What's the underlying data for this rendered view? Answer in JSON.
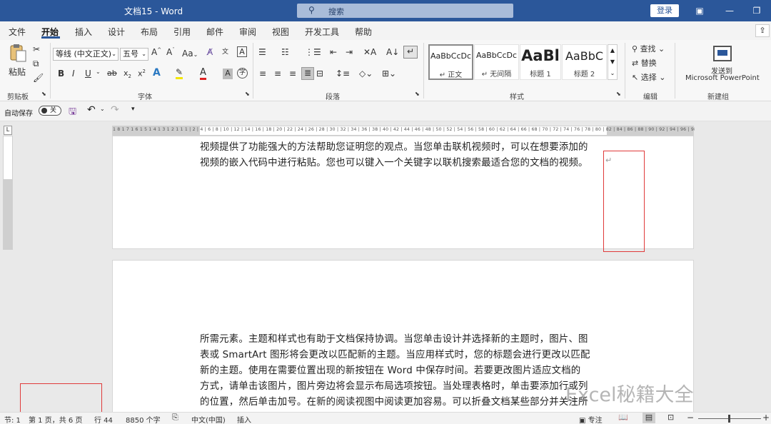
{
  "titlebar": {
    "title": "文档15 - Word",
    "search_placeholder": "搜索",
    "login": "登录"
  },
  "tabs": [
    "文件",
    "开始",
    "插入",
    "设计",
    "布局",
    "引用",
    "邮件",
    "审阅",
    "视图",
    "开发工具",
    "帮助"
  ],
  "clipboard": {
    "paste": "粘贴",
    "group": "剪贴板"
  },
  "font": {
    "name": "等线 (中文正文)",
    "size": "五号",
    "aa": "Aa",
    "group": "字体"
  },
  "paragraph": {
    "group": "段落"
  },
  "styles": {
    "items": [
      {
        "sample": "AaBbCcDc",
        "label": "正文"
      },
      {
        "sample": "AaBbCcDc",
        "label": "无间隔"
      },
      {
        "sample": "AaBl",
        "label": "标题 1"
      },
      {
        "sample": "AaBbC",
        "label": "标题 2"
      }
    ],
    "group": "样式"
  },
  "editing": {
    "find": "查找",
    "replace": "替换",
    "select": "选择",
    "group": "编辑"
  },
  "newgroup": {
    "send_line1": "发送到",
    "send_line2": "Microsoft PowerPoint",
    "group": "新建组"
  },
  "qat": {
    "autosave": "自动保存",
    "toggle": "关"
  },
  "ruler": "1 8 1 7 1 6 1 5 1 4 1 3 1 2 1 1 1 | 2 | 4 | 6 | 8 | 10 | 12 | 14 | 16 | 18 | 20 | 22 | 24 | 26 | 28 | 30 | 32 | 34 | 36 | 38 | 40 | 42 | 44 | 46 | 48 | 50 | 52 | 54 | 56 | 58 | 60 | 62 | 64 | 66 | 68 | 70 | 72 | 74 | 76 | 78 | 80 | 82 | 84 | 86 | 88 | 90 | 92 | 94 | 96 | 98 |40 | 41 | 42 | 43 | 44 | 45 | 46 | 47 | 48",
  "doc": {
    "page1_lines": [
      "视频提供了功能强大的方法帮助您证明您的观点。当您单击联机视频时，可以在想要添加的",
      "视频的嵌入代码中进行粘贴。您也可以键入一个关键字以联机搜索最适合您的文档的视频。"
    ],
    "page2_lines": [
      "所需元素。主题和样式也有助于文档保持协调。当您单击设计并选择新的主题时，图片、图",
      "表或 SmartArt 图形将会更改以匹配新的主题。当应用样式时，您的标题会进行更改以匹配",
      "新的主题。使用在需要位置出现的新按钮在 Word 中保存时间。若要更改图片适应文档的",
      "方式，请单击该图片，图片旁边将会显示布局选项按钮。当处理表格时，单击要添加行或列",
      "的位置，然后单击加号。在新的阅读视图中阅读更加容易。可以折叠文档某些部分并关注所"
    ]
  },
  "status": {
    "section": "节: 1",
    "page": "第 1 页，共 6 页",
    "line": "行 44",
    "words": "8850 个字",
    "lang": "中文(中国)",
    "mode": "插入",
    "focus": "专注"
  },
  "watermark": "Excel秘籍大全"
}
